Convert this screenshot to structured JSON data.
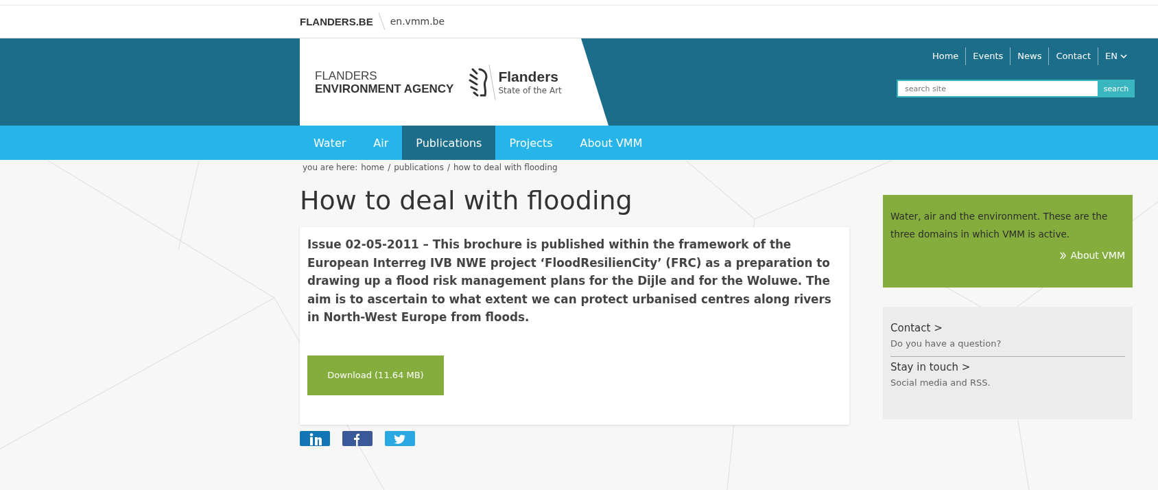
{
  "top_bar": {
    "site": "FLANDERS.BE",
    "domain": "en.vmm.be"
  },
  "header": {
    "agency_line_1": "FLANDERS",
    "agency_line_2": "ENVIRONMENT AGENCY",
    "brand": "Flanders",
    "tagline": "State of the Art",
    "utility_nav": [
      {
        "label": "Home",
        "kind": "link"
      },
      {
        "label": "Events",
        "kind": "link"
      },
      {
        "label": "News",
        "kind": "link"
      },
      {
        "label": "Contact",
        "kind": "link"
      },
      {
        "label": "EN",
        "kind": "dropdown"
      }
    ],
    "search": {
      "placeholder": "search site",
      "button": "search"
    }
  },
  "main_nav": [
    {
      "label": "Water",
      "selected": false
    },
    {
      "label": "Air",
      "selected": false
    },
    {
      "label": "Publications",
      "selected": true
    },
    {
      "label": "Projects",
      "selected": false
    },
    {
      "label": "About VMM",
      "selected": false
    }
  ],
  "breadcrumb": {
    "prefix": "you are here:",
    "separator": "/",
    "items": [
      "home",
      "publications",
      "how to deal with flooding"
    ]
  },
  "page": {
    "title": "How to deal with flooding",
    "summary": "Issue 02-05-2011 – This brochure is published within the framework of the European Interreg IVB NWE project ‘FloodResilienCity’ (FRC) as a preparation to drawing up a flood risk management plans for the Dijle and for the Woluwe. The aim is to ascertain to what extent we can protect urbanised centres along rivers in North-West Europe from floods.",
    "download": "Download (11.64 MB)",
    "share": [
      {
        "kind": "linkedin"
      },
      {
        "kind": "facebook"
      },
      {
        "kind": "twitter"
      }
    ]
  },
  "sidebar": {
    "promo": {
      "text": "Water, air and the environment. These are the three domains in which VMM is active.",
      "link": "About VMM"
    },
    "links": [
      {
        "title": "Contact >",
        "subtitle": "Do you have a question?"
      },
      {
        "title": "Stay in touch >",
        "subtitle": "Social media and RSS."
      }
    ]
  }
}
